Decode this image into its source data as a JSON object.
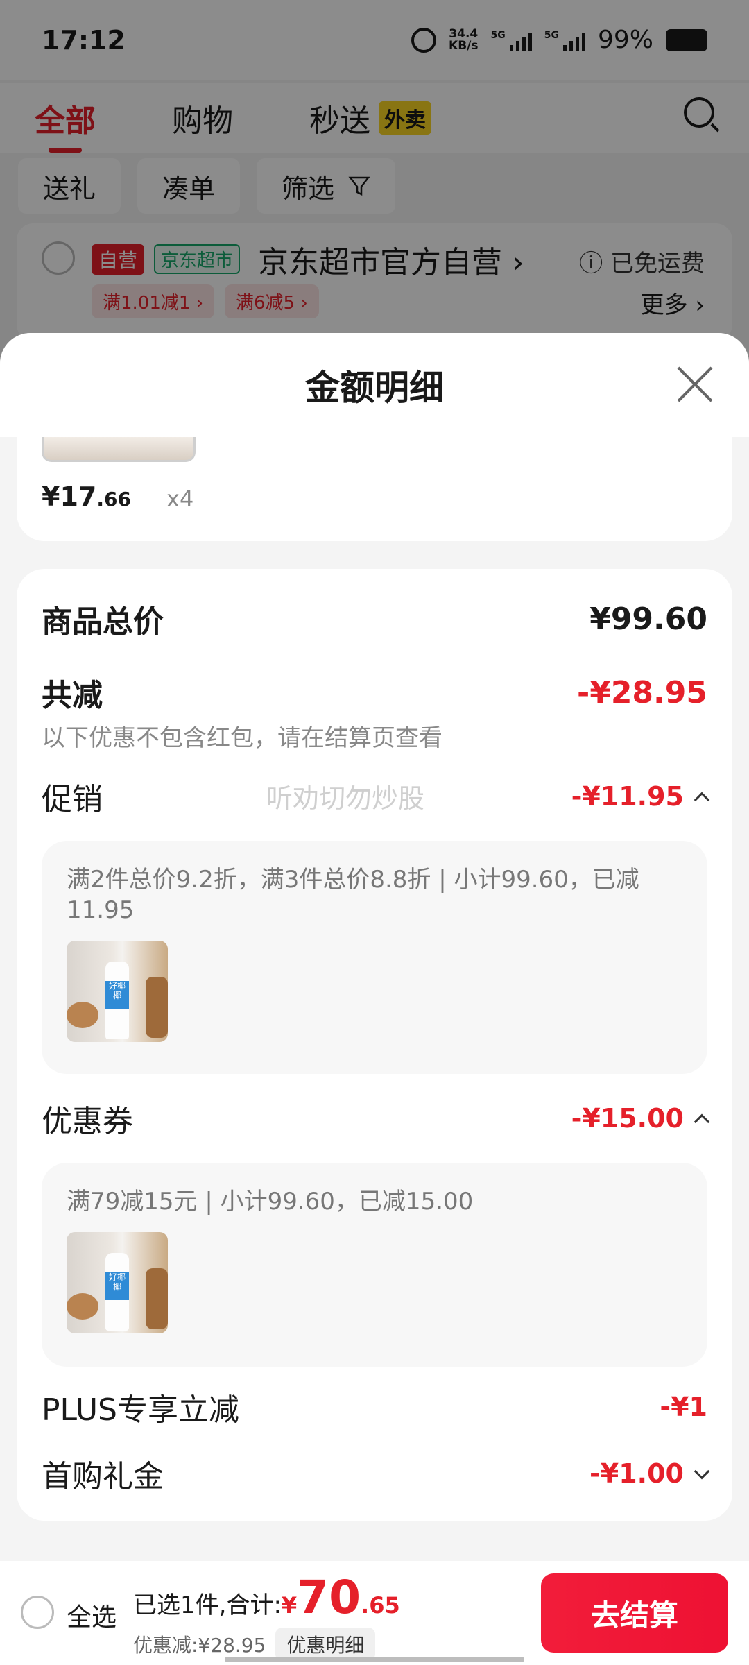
{
  "status_bar": {
    "time": "17:12",
    "net_speed_value": "34.4",
    "net_speed_unit": "KB/s",
    "signal1": "5G",
    "signal2": "5G",
    "battery": "99%"
  },
  "tabs": [
    {
      "label": "全部"
    },
    {
      "label": "购物"
    },
    {
      "label": "秒送"
    }
  ],
  "tab_badge": "外卖",
  "filters": {
    "gift": "送礼",
    "bundle": "凑单",
    "filter": "筛选"
  },
  "shop": {
    "tag_self": "自营",
    "tag_market": "京东超市",
    "name": "京东超市官方自营 ›",
    "shipping": "ⓘ 已免运费",
    "promo1": "满1.01减1 ›",
    "promo2": "满6减5 ›",
    "more": "更多 ›"
  },
  "sheet": {
    "title": "金额明细",
    "item": {
      "price_main": "¥17",
      "price_cents": ".66",
      "qty": "x4"
    },
    "total_label": "商品总价",
    "total_value": "¥99.60",
    "reduce_label": "共减",
    "reduce_value": "-¥28.95",
    "reduce_note": "以下优惠不包含红包，请在结算页查看",
    "watermark": "听劝切勿炒股",
    "promo_label": "促销",
    "promo_value": "-¥11.95",
    "promo_detail": "满2件总价9.2折，满3件总价8.8折 | 小计99.60，已减11.95",
    "coupon_label": "优惠券",
    "coupon_value": "-¥15.00",
    "coupon_detail": "满79减15元 | 小计99.60，已减15.00",
    "plus_label": "PLUS专享立减",
    "plus_value": "-¥1",
    "first_label": "首购礼金",
    "first_value": "-¥1.00",
    "product_label": "好椰椰"
  },
  "bottom": {
    "select_all": "全选",
    "summary_prefix": "已选1件,合计:",
    "yen": "¥",
    "total_int": "70",
    "total_cents": ".65",
    "discount": "优惠减:¥28.95",
    "detail_button": "优惠明细",
    "checkout": "去结算"
  },
  "colors": {
    "accent_red": "#e5202a",
    "badge_yellow": "#f9d523",
    "jd_green": "#17a86b"
  }
}
